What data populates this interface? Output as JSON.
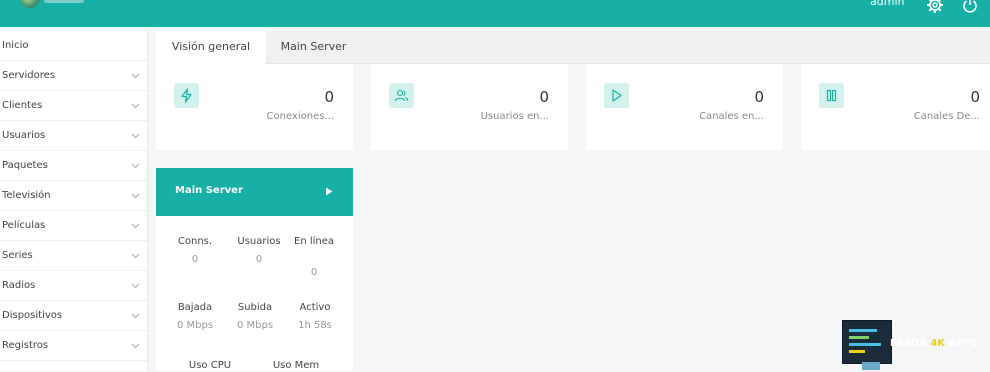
{
  "header": {
    "user": "admin",
    "icons": [
      "gear-icon",
      "power-icon"
    ]
  },
  "sidebar": {
    "items": [
      {
        "label": "Inicio",
        "has_chevron": false
      },
      {
        "label": "Servidores",
        "has_chevron": true
      },
      {
        "label": "Clientes",
        "has_chevron": true
      },
      {
        "label": "Usuarios",
        "has_chevron": true
      },
      {
        "label": "Paquetes",
        "has_chevron": true
      },
      {
        "label": "Televisión",
        "has_chevron": true
      },
      {
        "label": "Películas",
        "has_chevron": true
      },
      {
        "label": "Series",
        "has_chevron": true
      },
      {
        "label": "Radios",
        "has_chevron": true
      },
      {
        "label": "Dispositivos",
        "has_chevron": true
      },
      {
        "label": "Registros",
        "has_chevron": true
      }
    ]
  },
  "tabs": [
    {
      "label": "Visión general",
      "active": true
    },
    {
      "label": "Main Server",
      "active": false
    }
  ],
  "cards": [
    {
      "icon": "bolt-icon",
      "value": "0",
      "label": "Conexiones..."
    },
    {
      "icon": "users-icon",
      "value": "0",
      "label": "Usuarios en..."
    },
    {
      "icon": "play-icon",
      "value": "0",
      "label": "Canales en..."
    },
    {
      "icon": "pause-icon",
      "value": "0",
      "label": "Canales De..."
    }
  ],
  "server": {
    "name": "Main Server",
    "stats": [
      {
        "label": "Conns.",
        "value": "0"
      },
      {
        "label": "Usuarios",
        "value": "0"
      },
      {
        "label": "En línea",
        "value": "0"
      },
      {
        "label": "Bajada",
        "value": "0 Mbps"
      },
      {
        "label": "Subida",
        "value": "0 Mbps"
      },
      {
        "label": "Activo",
        "value": "1h 58s"
      }
    ],
    "usage": [
      {
        "label": "Uso CPU"
      },
      {
        "label": "Uso Mem"
      }
    ]
  },
  "watermark": {
    "part1": "ESSDA",
    "part2": "4K",
    "part3": "APPS"
  },
  "colors": {
    "accent": "#16b0a7",
    "icon_bg": "#d3f2ee"
  }
}
